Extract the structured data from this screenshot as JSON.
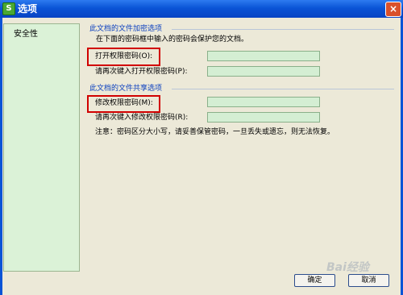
{
  "window": {
    "title": "选项",
    "app_icon_letter": "S",
    "close_symbol": "×"
  },
  "sidebar": {
    "items": [
      {
        "label": "安全性"
      }
    ]
  },
  "encryption_group": {
    "title": "此文档的文件加密选项",
    "description": "在下面的密码框中输入的密码会保护您的文档。",
    "open_password_label": "打开权限密码(O):",
    "open_password_value": "",
    "reenter_open_label": "请再次键入打开权限密码(P):",
    "reenter_open_value": ""
  },
  "sharing_group": {
    "title": "此文档的文件共享选项",
    "modify_password_label": "修改权限密码(M):",
    "modify_password_value": "",
    "reenter_modify_label": "请再次键入修改权限密码(R):",
    "reenter_modify_value": "",
    "note": "注意：密码区分大小写，请妥善保管密码，一旦丢失或遗忘，则无法恢复。"
  },
  "buttons": {
    "ok_label": "确定",
    "cancel_label": "取消"
  },
  "colors": {
    "title_bar": "#0a54d6",
    "highlight_box": "#d10000",
    "group_title": "#0a3fbf",
    "input_fill": "#d4eed3",
    "sidebar_fill": "#dbf2d7"
  }
}
